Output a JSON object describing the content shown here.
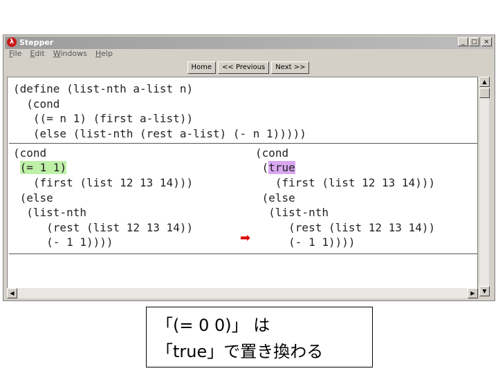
{
  "window": {
    "title": "Stepper",
    "controls": [
      "_",
      "□",
      "×"
    ]
  },
  "menu": [
    "File",
    "Edit",
    "Windows",
    "Help"
  ],
  "nav_buttons": {
    "home": "Home",
    "previous": "<< Previous",
    "next": "Next >>"
  },
  "definition": "(define (list-nth a-list n)\n  (cond\n   ((= n 1) (first a-list))\n   (else (list-nth (rest a-list) (- n 1)))))",
  "before": {
    "line1": "(cond",
    "line2_pre": " ",
    "line2_hl": "(= 1 1)",
    "line3": "   (first (list 12 13 14)))\n (else\n  (list-nth\n     (rest (list 12 13 14))\n     (- 1 1))))"
  },
  "after": {
    "line1": "(cond",
    "line2_pre": " (",
    "line2_hl": "true",
    "line3": "   (first (list 12 13 14)))\n (else\n  (list-nth\n     (rest (list 12 13 14))\n     (- 1 1))))"
  },
  "arrow_icon": "red-right-arrow",
  "colors": {
    "before_highlight": "#bff0a8",
    "after_highlight": "#d9a6f0",
    "arrow": "#e00000"
  },
  "caption": {
    "line1": "「(= 0 0)」 は",
    "line2": "「true」で置き換わる"
  }
}
